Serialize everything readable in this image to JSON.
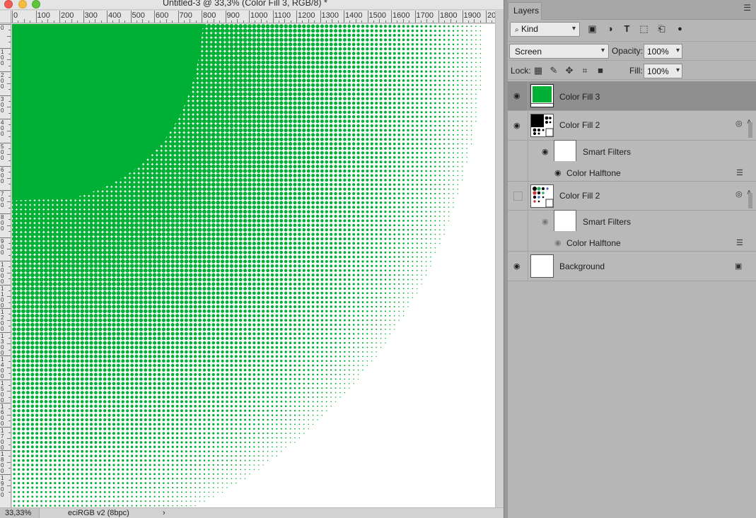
{
  "document": {
    "title": "Untitled-3 @ 33,3% (Color Fill 3, RGB/8) *",
    "zoom": "33,33%",
    "profile": "eciRGB v2 (8bpc)",
    "status_arrow": "›",
    "ruler_h_labels": [
      "0",
      "100",
      "200",
      "300",
      "400",
      "500",
      "600",
      "700",
      "800",
      "900",
      "1000",
      "1100",
      "1200",
      "1300",
      "1400",
      "1500",
      "1600",
      "1700",
      "1800",
      "1900",
      "20"
    ],
    "ruler_v_labels": [
      "0",
      "1 0 0",
      "2 0 0",
      "3 0 0",
      "4 0 0",
      "5 0 0",
      "6 0 0",
      "7 0 0",
      "8 0 0",
      "9 0 0",
      "1 0 0 0",
      "1 1 0 0",
      "1 2 0 0",
      "1 3 0 0",
      "1 4 0 0",
      "1 5 0 0",
      "1 6 0 0",
      "1 7 0 0",
      "1 8 0 0",
      "1 9 0 0"
    ],
    "canvas": {
      "halftone_color": "#00b034",
      "background": "#ffffff"
    }
  },
  "panel": {
    "tab_label": "Layers",
    "menu_icon": "panel-menu-icon",
    "filter": {
      "kind_label": "Kind",
      "search_icon": "⌕",
      "chevron": "⌵",
      "icons": [
        {
          "name": "pixel-layer-filter-icon",
          "glyph": "▣"
        },
        {
          "name": "adjustment-layer-filter-icon",
          "glyph": "◑"
        },
        {
          "name": "type-layer-filter-icon",
          "glyph": "T"
        },
        {
          "name": "shape-layer-filter-icon",
          "glyph": "⬚"
        },
        {
          "name": "smart-object-filter-icon",
          "glyph": "⎗"
        },
        {
          "name": "filter-toggle-icon",
          "glyph": "●"
        }
      ]
    },
    "blend_mode": "Screen",
    "opacity_label": "Opacity:",
    "opacity_value": "100%",
    "lock_label": "Lock:",
    "lock_icons": [
      {
        "name": "lock-transparent-pixels-icon",
        "glyph": "▦"
      },
      {
        "name": "lock-image-pixels-icon",
        "glyph": "✎"
      },
      {
        "name": "lock-position-icon",
        "glyph": "✥"
      },
      {
        "name": "lock-artboard-icon",
        "glyph": "⌗"
      },
      {
        "name": "lock-all-icon",
        "glyph": "■"
      }
    ],
    "fill_label": "Fill:",
    "fill_value": "100%",
    "layers": [
      {
        "name": "Color Fill 3",
        "visible": true,
        "selected": true,
        "thumb_color": "#00b034"
      },
      {
        "name": "Color Fill 2",
        "visible": true,
        "smart_filters_label": "Smart Filters",
        "filter_name": "Color Halftone"
      },
      {
        "name": "Color Fill 2",
        "visible": false,
        "smart_filters_label": "Smart Filters",
        "filter_name": "Color Halftone"
      },
      {
        "name": "Background",
        "visible": true
      }
    ],
    "eye_glyph": "◉",
    "smart_object_glyph": "◎",
    "filter_options_glyph": "☰",
    "lock_glyph": "▣",
    "collapse_glyph": "˄"
  }
}
